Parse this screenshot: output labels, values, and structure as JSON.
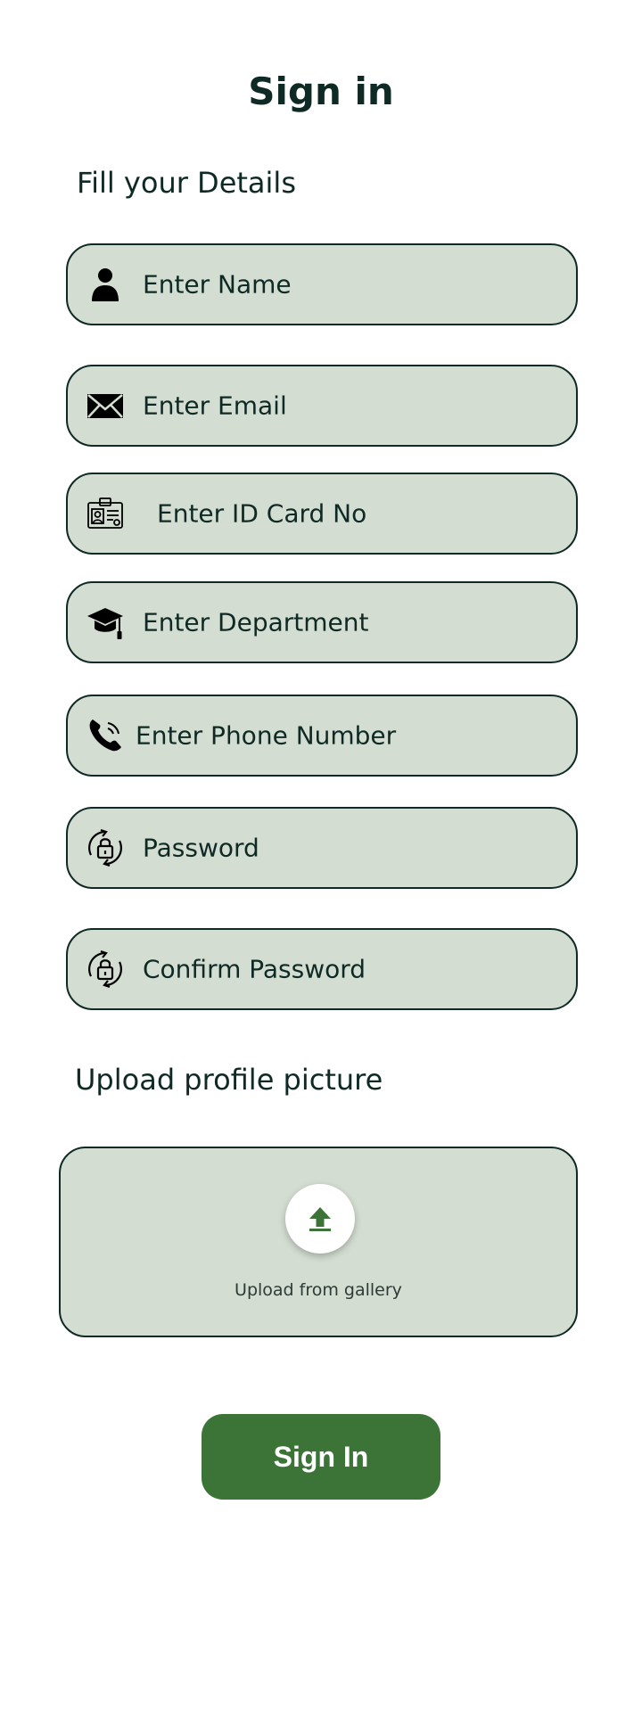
{
  "page": {
    "title": "Sign in",
    "details_label": "Fill your Details",
    "upload_label": "Upload profile picture"
  },
  "fields": [
    {
      "icon": "person-icon",
      "placeholder": "Enter Name"
    },
    {
      "icon": "envelope-icon",
      "placeholder": "Enter Email"
    },
    {
      "icon": "id-card-icon",
      "placeholder": "Enter ID Card No"
    },
    {
      "icon": "graduation-cap-icon",
      "placeholder": "Enter Department"
    },
    {
      "icon": "phone-icon",
      "placeholder": "Enter Phone Number"
    },
    {
      "icon": "lock-refresh-icon",
      "placeholder": "Password"
    },
    {
      "icon": "lock-refresh-icon",
      "placeholder": "Confirm Password"
    }
  ],
  "upload": {
    "icon": "upload-arrow-icon",
    "text": "Upload from gallery"
  },
  "submit": {
    "label": "Sign In"
  },
  "colors": {
    "field_bg": "#d3ddd1",
    "border": "#0f2a25",
    "primary": "#3c7438",
    "text": "#0f2a25"
  }
}
